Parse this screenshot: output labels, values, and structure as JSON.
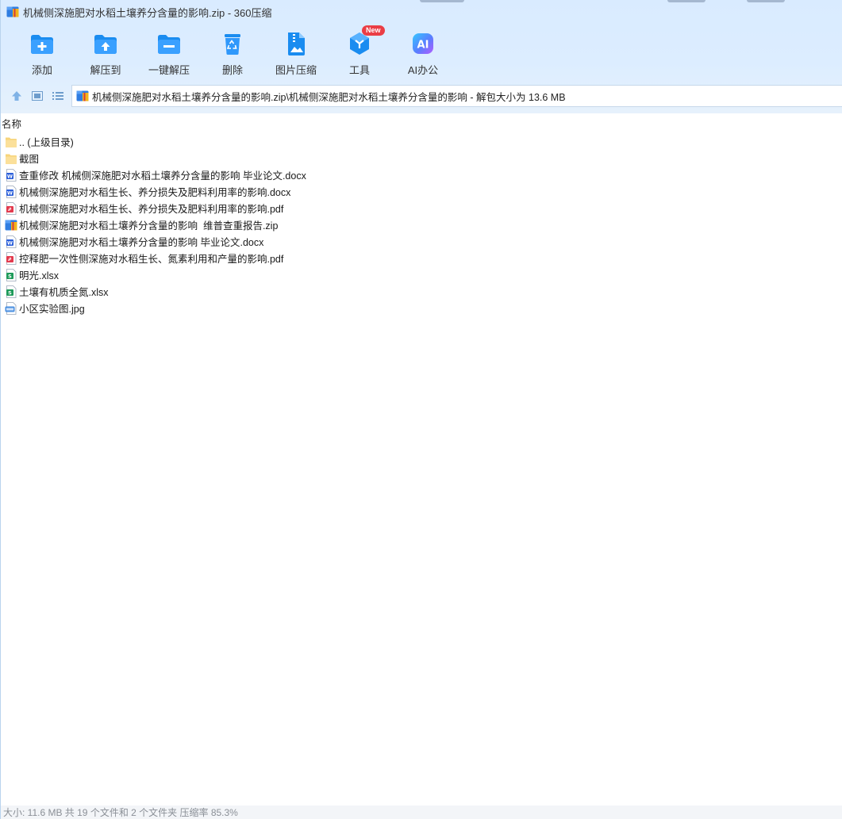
{
  "window": {
    "title": "机械侧深施肥对水稻土壤养分含量的影响.zip - 360压缩"
  },
  "toolbar": {
    "items": [
      {
        "label": "添加",
        "icon": "add-archive-icon"
      },
      {
        "label": "解压到",
        "icon": "extract-to-icon"
      },
      {
        "label": "一键解压",
        "icon": "one-click-extract-icon"
      },
      {
        "label": "删除",
        "icon": "recycle-bin-icon"
      },
      {
        "label": "图片压缩",
        "icon": "image-compress-icon"
      },
      {
        "label": "工具",
        "icon": "tools-cube-icon",
        "badge": "New"
      },
      {
        "label": "AI办公",
        "icon": "ai-office-icon"
      }
    ]
  },
  "address": {
    "path": "机械侧深施肥对水稻土壤养分含量的影响.zip\\机械侧深施肥对水稻土壤养分含量的影响 - 解包大小为 13.6 MB"
  },
  "list": {
    "column_name": "名称",
    "files": [
      {
        "name": ".. (上级目录)",
        "type": "folder"
      },
      {
        "name": "截图",
        "type": "folder"
      },
      {
        "name": "查重修改 机械侧深施肥对水稻土壤养分含量的影响 毕业论文.docx",
        "type": "word"
      },
      {
        "name": "机械侧深施肥对水稻生长、养分损失及肥料利用率的影响.docx",
        "type": "word"
      },
      {
        "name": "机械侧深施肥对水稻生长、养分损失及肥料利用率的影响.pdf",
        "type": "pdf"
      },
      {
        "name": "机械侧深施肥对水稻土壤养分含量的影响  维普查重报告.zip",
        "type": "zip"
      },
      {
        "name": "机械侧深施肥对水稻土壤养分含量的影响 毕业论文.docx",
        "type": "word"
      },
      {
        "name": "控释肥一次性侧深施对水稻生长、氮素利用和产量的影响.pdf",
        "type": "pdf"
      },
      {
        "name": "明光.xlsx",
        "type": "excel"
      },
      {
        "name": "土壤有机质全氮.xlsx",
        "type": "excel"
      },
      {
        "name": "小区实验图.jpg",
        "type": "jpg"
      }
    ]
  },
  "status": {
    "text": "大小: 11.6 MB 共 19 个文件和 2 个文件夹 压缩率 85.3%"
  },
  "colors": {
    "accent_blue": "#1a8cf0",
    "folder_yellow": "#f7d47a",
    "word_blue": "#2b5fd9",
    "pdf_red": "#e23a4e",
    "excel_green": "#1e9a5a",
    "badge_red": "#ea3d45"
  }
}
